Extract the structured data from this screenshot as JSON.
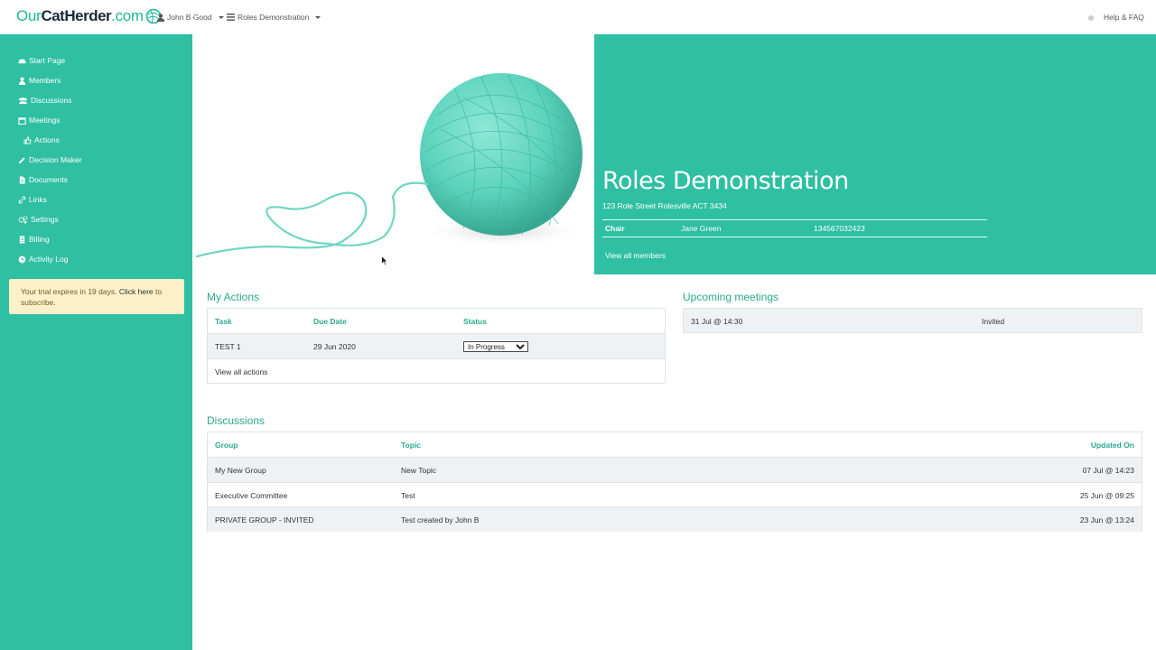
{
  "logo": {
    "part1": "Our",
    "part2": "CatHerder",
    "part3": ".com"
  },
  "topnav": {
    "user": "John B Good",
    "org": "Roles Demonstration",
    "help": "Help & FAQ"
  },
  "sidebar": {
    "items": [
      {
        "label": "Start Page",
        "icon": "car-icon"
      },
      {
        "label": "Members",
        "icon": "user-icon"
      },
      {
        "label": "Discussions",
        "icon": "users-icon"
      },
      {
        "label": "Meetings",
        "icon": "calendar-icon"
      },
      {
        "label": "Actions",
        "icon": "thumbs-up-icon"
      },
      {
        "label": "Decision Maker",
        "icon": "pencil-icon"
      },
      {
        "label": "Documents",
        "icon": "file-icon"
      },
      {
        "label": "Links",
        "icon": "link-icon"
      },
      {
        "label": "Settings",
        "icon": "gears-icon"
      },
      {
        "label": "Billing",
        "icon": "receipt-icon"
      },
      {
        "label": "Activity Log",
        "icon": "clock-icon"
      }
    ],
    "trial_text": "Your trial expires in 19 days.",
    "trial_link": "Click here",
    "trial_suffix": "to",
    "trial_line2": "subscribe."
  },
  "hero": {
    "title": "Roles Demonstration",
    "address": "123 Role Street Rolesville ACT 3434",
    "role": "Chair",
    "name": "Jane Green",
    "phone": "134567032423",
    "view_all": "View all members"
  },
  "my_actions": {
    "title": "My Actions",
    "headers": [
      "Task",
      "Due Date",
      "Status"
    ],
    "row": {
      "task": "TEST 1",
      "due": "29 Jun 2020",
      "status": "In Progress"
    },
    "view_all": "View all actions"
  },
  "upcoming": {
    "title": "Upcoming meetings",
    "row": {
      "date": "31 Jul @ 14:30",
      "status": "Invited"
    }
  },
  "discussions": {
    "title": "Discussions",
    "headers": [
      "Group",
      "Topic",
      "Updated On"
    ],
    "rows": [
      {
        "group": "My New Group",
        "topic": "New Topic",
        "updated": "07 Jul @ 14:23"
      },
      {
        "group": "Executive Committee",
        "topic": "Test",
        "updated": "25 Jun @ 09:25"
      },
      {
        "group": "PRIVATE GROUP - INVITED",
        "topic": "Test created by John B",
        "updated": "23 Jun @ 13:24"
      }
    ]
  },
  "colors": {
    "brand": "#2fbfa2",
    "accent_text": "#2aa98f",
    "trial_bg": "#fbf0c8"
  }
}
